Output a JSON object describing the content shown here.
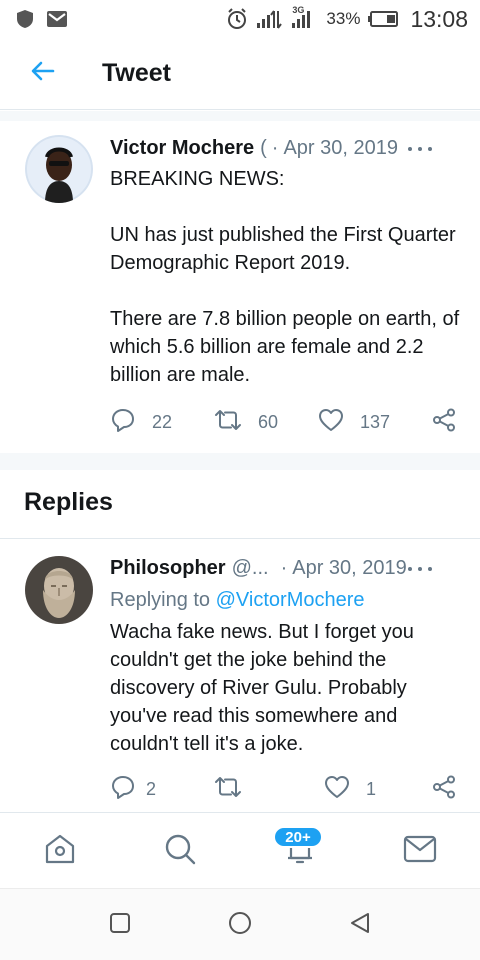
{
  "status_bar": {
    "battery_percent": "33%",
    "time": "13:08",
    "network_label": "3G"
  },
  "header": {
    "title": "Tweet"
  },
  "main_tweet": {
    "author": "Victor Mochere",
    "handle": "(",
    "separator": "·",
    "date": "Apr 30, 2019",
    "paragraphs": [
      "BREAKING NEWS:",
      "UN has just published the First Quarter Demographic Report 2019.",
      "There are 7.8 billion people on earth, of which 5.6 billion are female and 2.2 billion are male."
    ],
    "reply_count": "22",
    "retweet_count": "60",
    "like_count": "137"
  },
  "replies_section": {
    "title": "Replies"
  },
  "reply_tweet": {
    "author": "Philosopher",
    "handle": "@...",
    "separator": "·",
    "date": "Apr 30, 2019",
    "replying_prefix": "Replying to",
    "replying_to": "@VictorMochere",
    "body": "Wacha fake news. But I forget you couldn't get the joke behind the discovery of River Gulu. Probably you've read this somewhere and couldn't tell it's a joke.",
    "reply_count": "2",
    "retweet_count": "",
    "like_count": "1"
  },
  "bottom_nav": {
    "notifications_badge": "20+",
    "items": [
      "home-icon",
      "search-icon",
      "notifications-icon",
      "messages-icon"
    ]
  },
  "colors": {
    "accent": "#1da1f2",
    "text_primary": "#14171a",
    "text_secondary": "#657786",
    "divider": "#e1e8ed"
  }
}
